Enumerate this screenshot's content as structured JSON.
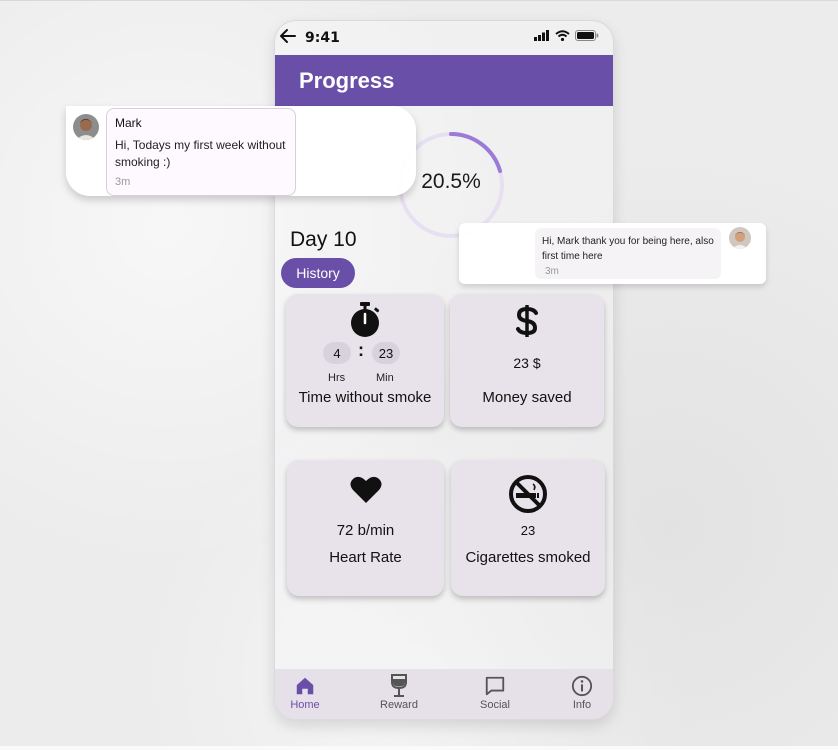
{
  "status_bar": {
    "time": "9:41"
  },
  "header": {
    "title": "Progress"
  },
  "progress": {
    "percent_label": "20.5%",
    "fraction": 0.205
  },
  "day": {
    "label": "Day 10"
  },
  "history": {
    "label": "History"
  },
  "cards": {
    "time": {
      "hours": "4",
      "colon": ":",
      "minutes": "23",
      "hrs_unit": "Hrs",
      "min_unit": "Min",
      "label": "Time without smoke",
      "icon": "stopwatch-icon"
    },
    "money": {
      "value": "23 $",
      "label": "Money saved",
      "icon": "dollar-icon"
    },
    "heart": {
      "value": "72 b/min",
      "label": "Heart Rate",
      "icon": "heart-icon"
    },
    "cigs": {
      "value": "23",
      "label": "Cigarettes smoked",
      "icon": "no-smoking-icon"
    }
  },
  "nav": {
    "items": [
      {
        "label": "Home",
        "icon": "home-icon",
        "active": true
      },
      {
        "label": "Reward",
        "icon": "wine-glass-icon"
      },
      {
        "label": "Social",
        "icon": "chat-icon"
      },
      {
        "label": "Info",
        "icon": "info-icon"
      }
    ]
  },
  "chat": {
    "message1": {
      "name": "Mark",
      "text": "Hi, Todays my first week without smoking :)",
      "time": "3m"
    },
    "message2": {
      "text": "Hi, Mark thank you for being here, also first time here",
      "time": "3m"
    }
  },
  "colors": {
    "accent": "#6a4fa8",
    "ring_light": "#e7e0f2",
    "card_bg": "#e8e2ea"
  }
}
